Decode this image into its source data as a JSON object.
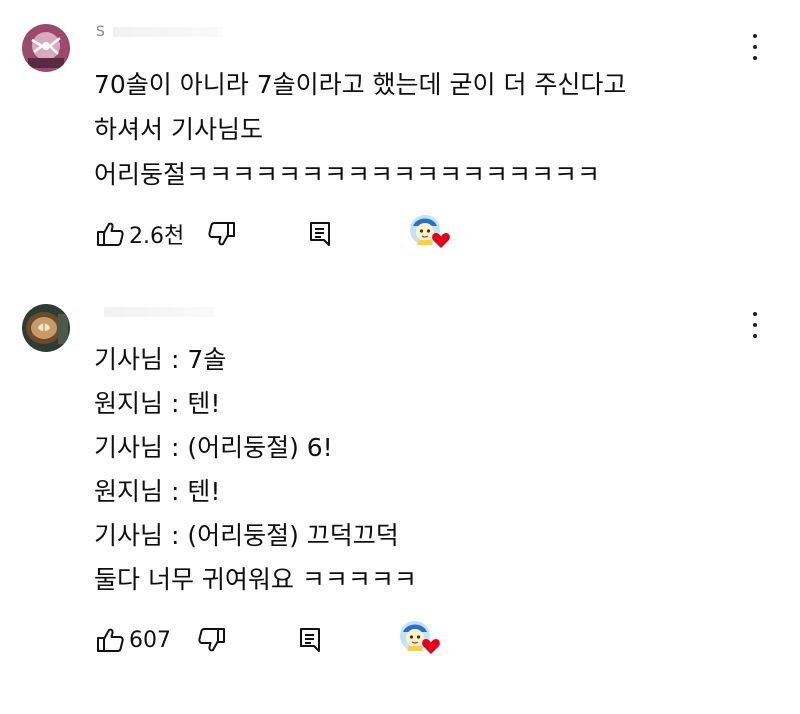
{
  "comments": [
    {
      "author": "S",
      "lines": [
        "70솔이 아니라 7솔이라고 했는데 굳이 더 주신다고",
        "하셔서 기사님도",
        "어리둥절ㅋㅋㅋㅋㅋㅋㅋㅋㅋㅋㅋㅋㅋㅋㅋㅋㅋㅋ"
      ],
      "likes": "2.6천",
      "icons": [
        "avatar-icon",
        "thumbs-up-icon",
        "thumbs-down-icon",
        "reply-icon",
        "creator-heart-icon",
        "more-options-icon"
      ]
    },
    {
      "author": "",
      "lines": [
        "기사님 : 7솔",
        "원지님 : 텐!",
        "기사님 : (어리둥절) 6!",
        "원지님 : 텐!",
        "기사님 : (어리둥절) 끄덕끄덕",
        "둘다 너무 귀여워요 ㅋㅋㅋㅋㅋ"
      ],
      "likes": "607",
      "icons": [
        "avatar-icon",
        "thumbs-up-icon",
        "thumbs-down-icon",
        "reply-icon",
        "creator-heart-icon",
        "more-options-icon"
      ]
    }
  ],
  "colors": {
    "heart": "#e2001a",
    "text": "#0f0f0f",
    "muted": "#888888"
  }
}
